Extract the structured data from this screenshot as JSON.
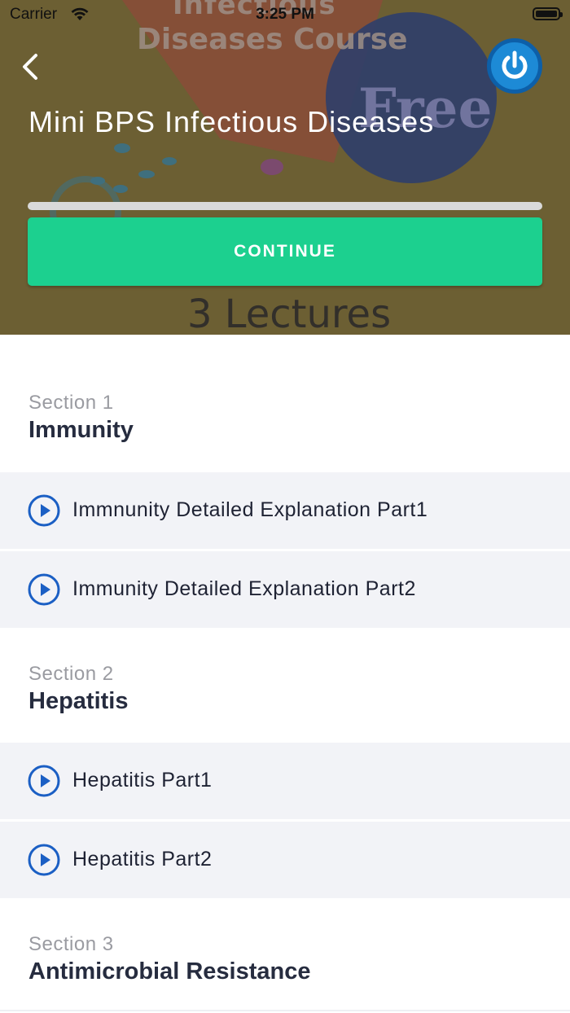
{
  "status_bar": {
    "carrier": "Carrier",
    "time": "3:25 PM"
  },
  "hero": {
    "banner_line1": "Infectious",
    "banner_line2": "Diseases Course",
    "banner_free": "Free",
    "banner_lectures": "3 Lectures",
    "course_title": "Mini BPS Infectious Diseases",
    "progress_percent": 0,
    "continue_label": "CONTINUE"
  },
  "colors": {
    "accent_green": "#1cd08f",
    "play_blue": "#1b5fc4",
    "power_blue": "#1d8ad6"
  },
  "sections": [
    {
      "number": "Section 1",
      "title": "Immunity",
      "lessons": [
        "Immnunity Detailed Explanation Part1",
        "Immunity Detailed Explanation Part2"
      ]
    },
    {
      "number": "Section 2",
      "title": "Hepatitis",
      "lessons": [
        "Hepatitis Part1",
        "Hepatitis Part2"
      ]
    },
    {
      "number": "Section 3",
      "title": "Antimicrobial Resistance",
      "lessons": []
    }
  ]
}
